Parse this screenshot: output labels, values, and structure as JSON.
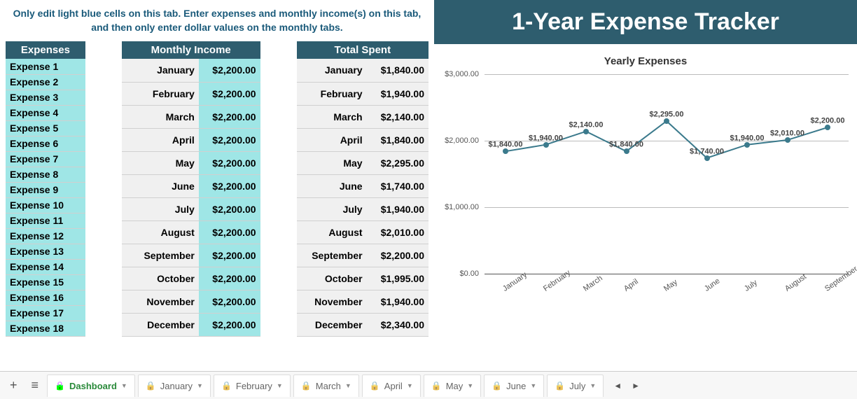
{
  "instruction": "Only edit light blue cells on this tab. Enter expenses and monthly income(s) on this tab, and then only enter dollar values on the monthly tabs.",
  "title": "1-Year Expense Tracker",
  "headers": {
    "expenses": "Expenses",
    "income": "Monthly Income",
    "spent": "Total Spent"
  },
  "expenses": [
    "Expense 1",
    "Expense 2",
    "Expense 3",
    "Expense 4",
    "Expense 5",
    "Expense 6",
    "Expense 7",
    "Expense 8",
    "Expense 9",
    "Expense 10",
    "Expense 11",
    "Expense 12",
    "Expense 13",
    "Expense 14",
    "Expense 15",
    "Expense 16",
    "Expense 17",
    "Expense 18"
  ],
  "months": [
    "January",
    "February",
    "March",
    "April",
    "May",
    "June",
    "July",
    "August",
    "September",
    "October",
    "November",
    "December"
  ],
  "income_values": [
    "$2,200.00",
    "$2,200.00",
    "$2,200.00",
    "$2,200.00",
    "$2,200.00",
    "$2,200.00",
    "$2,200.00",
    "$2,200.00",
    "$2,200.00",
    "$2,200.00",
    "$2,200.00",
    "$2,200.00"
  ],
  "spent_values": [
    "$1,840.00",
    "$1,940.00",
    "$2,140.00",
    "$1,840.00",
    "$2,295.00",
    "$1,740.00",
    "$1,940.00",
    "$2,010.00",
    "$2,200.00",
    "$1,995.00",
    "$1,940.00",
    "$2,340.00"
  ],
  "chart_data": {
    "type": "line",
    "title": "Yearly Expenses",
    "categories": [
      "January",
      "February",
      "March",
      "April",
      "May",
      "June",
      "July",
      "August",
      "September"
    ],
    "values": [
      1840,
      1940,
      2140,
      1840,
      2295,
      1740,
      1940,
      2010,
      2200
    ],
    "value_labels": [
      "$1,840.00",
      "$1,940.00",
      "$2,140.00",
      "$1,840.00",
      "$2,295.00",
      "$1,740.00",
      "$1,940.00",
      "$2,010.00",
      "$2,200.00"
    ],
    "ylim": [
      0,
      3000
    ],
    "yticks": [
      "$0.00",
      "$1,000.00",
      "$2,000.00",
      "$3,000.00"
    ],
    "ytick_values": [
      0,
      1000,
      2000,
      3000
    ]
  },
  "tabs": [
    "Dashboard",
    "January",
    "February",
    "March",
    "April",
    "May",
    "June",
    "July"
  ],
  "active_tab": "Dashboard"
}
